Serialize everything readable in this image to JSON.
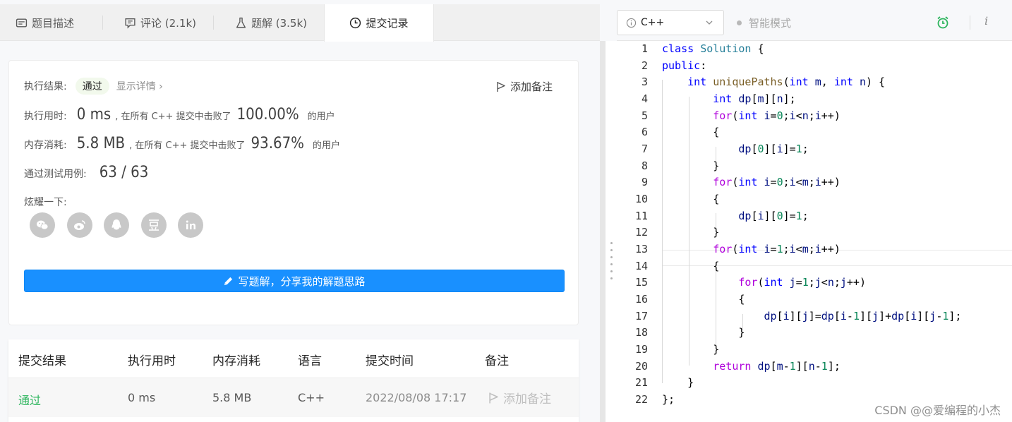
{
  "tabs": [
    {
      "label": "题目描述",
      "icon": "description-icon"
    },
    {
      "label": "评论 (2.1k)",
      "icon": "comment-icon"
    },
    {
      "label": "题解 (3.5k)",
      "icon": "flask-icon"
    },
    {
      "label": "提交记录",
      "icon": "clock-icon"
    }
  ],
  "result": {
    "label": "执行结果:",
    "status": "通过",
    "detail": "显示详情",
    "add_note": "添加备注",
    "time_label": "执行用时:",
    "time_value": "0 ms",
    "time_mid": ", 在所有 C++ 提交中击败了",
    "time_pct": "100.00%",
    "time_suffix": "的用户",
    "mem_label": "内存消耗:",
    "mem_value": "5.8 MB",
    "mem_mid": ", 在所有 C++ 提交中击败了",
    "mem_pct": "93.67%",
    "mem_suffix": "的用户",
    "cases_label": "通过测试用例:",
    "cases_value": "63 / 63",
    "share_label": "炫耀一下:",
    "share_button": "写题解，分享我的解题思路"
  },
  "social": [
    "wechat-icon",
    "weibo-icon",
    "qq-icon",
    "douban-icon",
    "linkedin-icon"
  ],
  "table": {
    "headers": [
      "提交结果",
      "执行用时",
      "内存消耗",
      "语言",
      "提交时间",
      "备注"
    ],
    "row": {
      "result": "通过",
      "time": "0 ms",
      "memory": "5.8 MB",
      "language": "C++",
      "submitted": "2022/08/08 17:17",
      "note": "添加备注"
    }
  },
  "editor": {
    "language": "C++",
    "mode": "智能模式",
    "lines": [
      "class Solution {",
      "public:",
      "    int uniquePaths(int m, int n) {",
      "        int dp[m][n];",
      "        for(int i=0;i<n;i++)",
      "        {",
      "            dp[0][i]=1;",
      "        }",
      "        for(int i=0;i<m;i++)",
      "        {",
      "            dp[i][0]=1;",
      "        }",
      "        for(int i=1;i<m;i++)",
      "        {",
      "            for(int j=1;j<n;j++)",
      "            {",
      "                dp[i][j]=dp[i-1][j]+dp[i][j-1];",
      "            }",
      "        }",
      "        return dp[m-1][n-1];",
      "    }",
      "};"
    ]
  },
  "watermark": "CSDN @@爱编程的小杰",
  "colors": {
    "accent": "#1990ff",
    "success": "#2db55d",
    "keyword": "#0000ff",
    "number": "#098658"
  }
}
